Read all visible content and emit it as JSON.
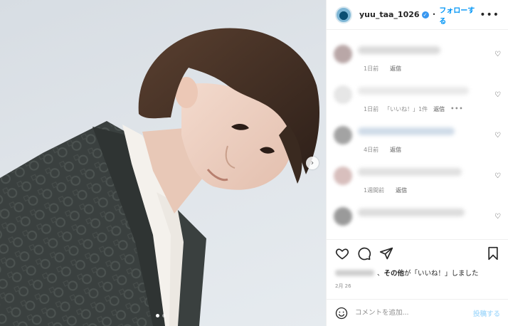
{
  "post": {
    "image_pages": 2,
    "active_page": 1
  },
  "header": {
    "username": "yuu_taa_1026",
    "verified_icon": "verified-badge-icon",
    "separator": "•",
    "follow_label": "フォローする",
    "more_label": "•••"
  },
  "comments": [
    {
      "time": "1日前",
      "likes": "",
      "reply": "返信",
      "more": "",
      "avatar_color": "#b9a7a7",
      "text_color": "#dadada",
      "text_width": 0.58
    },
    {
      "time": "1日前",
      "likes": "「いいね！」1件",
      "reply": "返信",
      "more": "•••",
      "avatar_color": "#e6e6e6",
      "text_color": "#e9e9e9",
      "text_width": 0.78
    },
    {
      "time": "4日前",
      "likes": "",
      "reply": "返信",
      "more": "",
      "avatar_color": "#a3a3a3",
      "text_color": "#cfdbe8",
      "text_width": 0.68
    },
    {
      "time": "1週間前",
      "likes": "",
      "reply": "返信",
      "more": "",
      "avatar_color": "#d8bfbd",
      "text_color": "#e0e0e0",
      "text_width": 0.73
    },
    {
      "time": "",
      "likes": "",
      "reply": "",
      "more": "",
      "avatar_color": "#9a9a9a",
      "text_color": "#dcdcdc",
      "text_width": 0.75
    }
  ],
  "actions": {
    "like_icon": "heart-icon",
    "comment_icon": "comment-bubble-icon",
    "share_icon": "paper-plane-icon",
    "save_icon": "bookmark-icon"
  },
  "likes_line": {
    "middle": "、",
    "bold": "その他",
    "suffix": "が「いいね！」しました"
  },
  "date": "2月 26",
  "add_comment": {
    "placeholder": "コメントを追加...",
    "post_label": "投稿する"
  },
  "colors": {
    "accent": "#0095f6",
    "verified": "#3897f0",
    "post_disabled": "#b2dffc",
    "muted": "#8e8e8e"
  }
}
